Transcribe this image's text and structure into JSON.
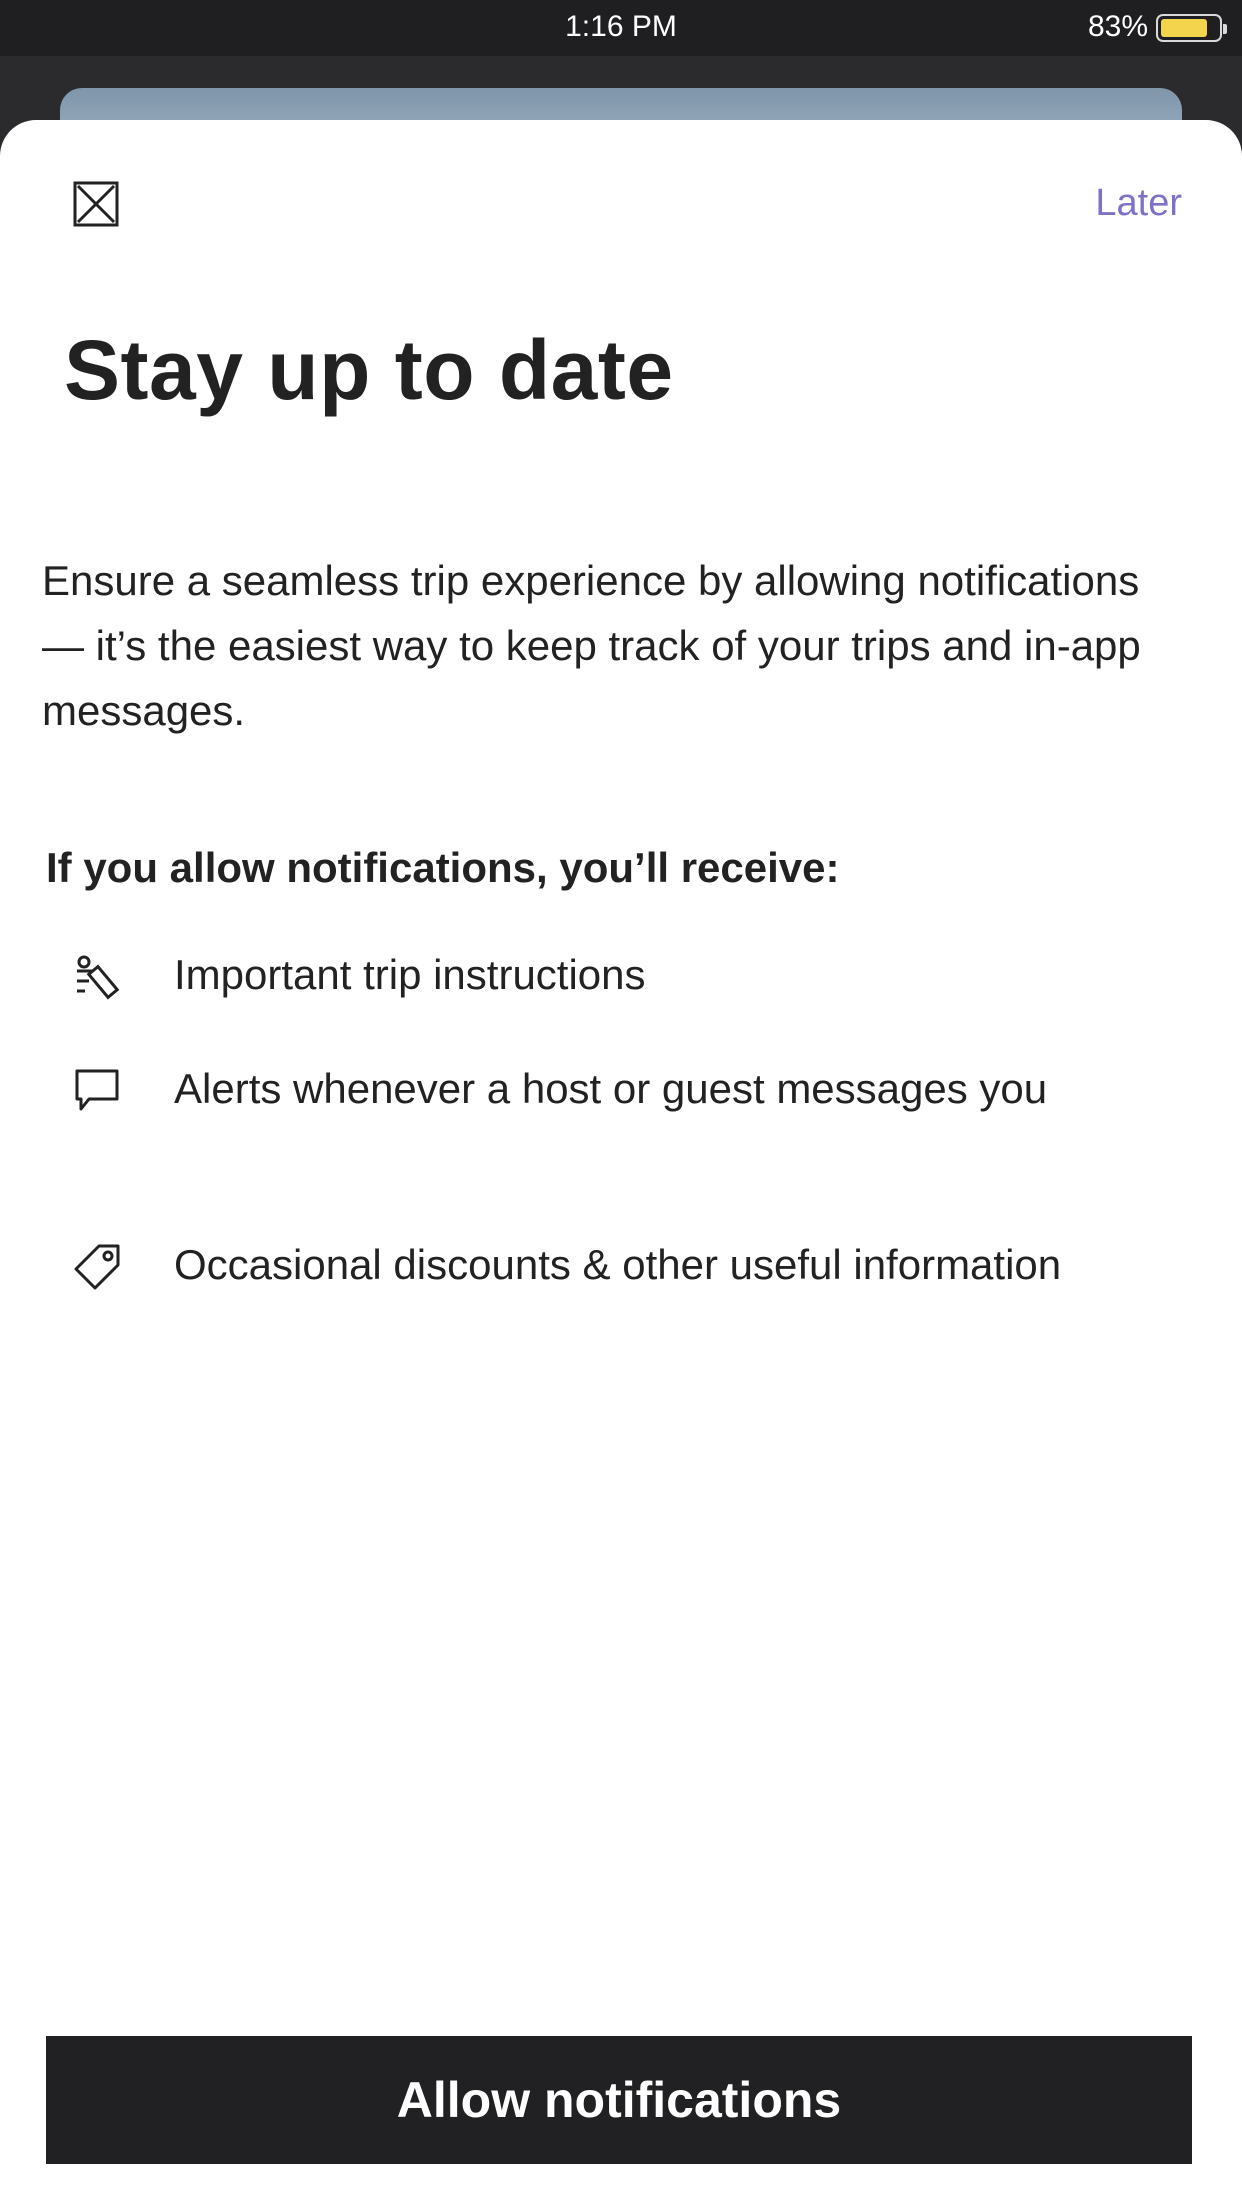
{
  "status_bar": {
    "time": "1:16 PM",
    "battery_percent": "83%",
    "battery_level": 0.83,
    "battery_color": "#f4d34d"
  },
  "header": {
    "close_icon": "close-icon",
    "later_label": "Later",
    "later_color": "#7f71c8"
  },
  "content": {
    "title": "Stay up to date",
    "intro": "Ensure a seamless trip experience by allowing notifications — it’s the easiest way to keep track of your trips and in-app messages.",
    "subhead": "If you allow notifications, you’ll receive:",
    "benefits": [
      {
        "icon": "trip-instructions-icon",
        "text": "Important trip instructions"
      },
      {
        "icon": "message-bubble-icon",
        "text": "Alerts whenever a host or guest messages you"
      },
      {
        "icon": "price-tag-icon",
        "text": "Occasional discounts & other useful information"
      }
    ]
  },
  "footer": {
    "allow_label": "Allow notifications",
    "button_color": "#212022"
  }
}
